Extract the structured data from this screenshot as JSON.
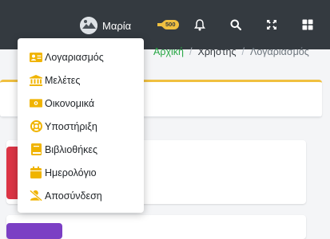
{
  "topbar": {
    "user_name": "Μαρία",
    "notification_badge": "500",
    "icons": [
      "avatar-icon",
      "megaphone-icon",
      "bell-icon",
      "search-icon",
      "expand-icon",
      "grid-icon"
    ],
    "background": "#343a40",
    "badge_color": "#f0c040"
  },
  "breadcrumb": {
    "home": "Αρχική",
    "users": "Χρήστης",
    "current": "Λογαριασμός",
    "separator": "/"
  },
  "user_menu": {
    "items": [
      {
        "label": "Λογαριασμός",
        "icon": "id-card-icon"
      },
      {
        "label": "Μελέτες",
        "icon": "institution-icon"
      },
      {
        "label": "Οικονομικά",
        "icon": "money-icon"
      },
      {
        "label": "Υποστήριξη",
        "icon": "lifebuoy-icon"
      },
      {
        "label": "Βιβλιοθήκες",
        "icon": "book-icon"
      },
      {
        "label": "Ημερολόγιο",
        "icon": "calendar-icon"
      },
      {
        "label": "Αποσύνδεση",
        "icon": "user-slash-icon"
      }
    ],
    "icon_color": "#f0b400"
  }
}
